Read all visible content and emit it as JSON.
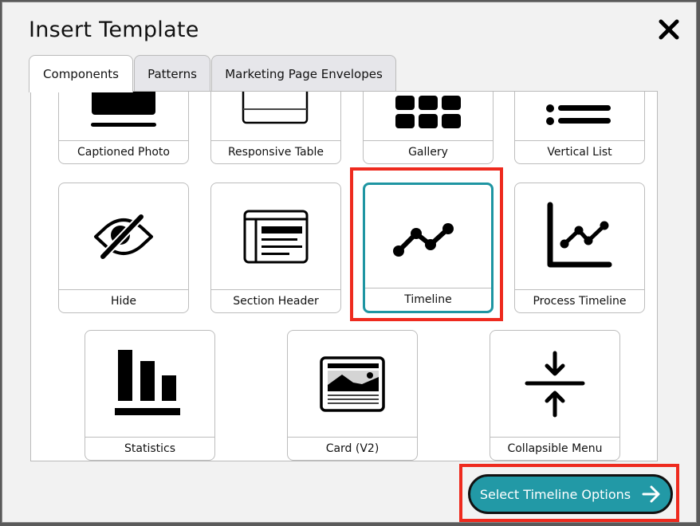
{
  "dialog": {
    "title": "Insert Template",
    "close_icon": "close-icon"
  },
  "tabs": [
    {
      "label": "Components",
      "active": true
    },
    {
      "label": "Patterns",
      "active": false
    },
    {
      "label": "Marketing Page Envelopes",
      "active": false
    }
  ],
  "components": [
    {
      "label": "Captioned Photo",
      "icon": "captioned-photo-icon"
    },
    {
      "label": "Responsive Table",
      "icon": "table-icon"
    },
    {
      "label": "Gallery",
      "icon": "gallery-grid-icon"
    },
    {
      "label": "Vertical List",
      "icon": "list-icon"
    },
    {
      "label": "Hide",
      "icon": "eye-slash-icon"
    },
    {
      "label": "Section Header",
      "icon": "section-header-icon"
    },
    {
      "label": "Timeline",
      "icon": "line-chart-icon",
      "selected": true
    },
    {
      "label": "Process Timeline",
      "icon": "chart-axis-icon"
    },
    {
      "label": "Statistics",
      "icon": "bar-chart-icon"
    },
    {
      "label": "Card (V2)",
      "icon": "card-image-icon"
    },
    {
      "label": "Collapsible Menu",
      "icon": "collapse-arrows-icon"
    }
  ],
  "footer": {
    "primary_button": "Select Timeline Options",
    "primary_icon": "arrow-right-icon"
  },
  "colors": {
    "accent": "#2299a6",
    "selected_border": "#1e95a2",
    "highlight": "#ee2a1e"
  }
}
